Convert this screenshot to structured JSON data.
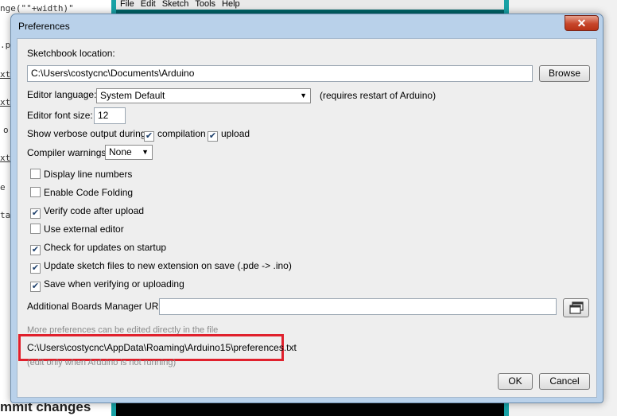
{
  "background": {
    "left_fragments": [
      "nge(\"\"+width)\"",
      ".pe",
      "xt",
      "xt",
      "o",
      "xt",
      "e",
      "ta"
    ],
    "commit_text": "mmit changes",
    "ide_menu": [
      "File",
      "Edit",
      "Sketch",
      "Tools",
      "Help"
    ]
  },
  "dialog": {
    "title": "Preferences",
    "close_glyph": "✕",
    "sketchbook": {
      "label": "Sketchbook location:",
      "value": "C:\\Users\\costycnc\\Documents\\Arduino",
      "browse_label": "Browse"
    },
    "language": {
      "label": "Editor language:",
      "selected": "System Default",
      "note": "(requires restart of Arduino)"
    },
    "font_size": {
      "label": "Editor font size:",
      "value": "12"
    },
    "verbose": {
      "label": "Show verbose output during:",
      "compilation": {
        "label": "compilation",
        "checked": true
      },
      "upload": {
        "label": "upload",
        "checked": true
      }
    },
    "warnings": {
      "label": "Compiler warnings:",
      "selected": "None"
    },
    "options": [
      {
        "label": "Display line numbers",
        "checked": false
      },
      {
        "label": "Enable Code Folding",
        "checked": false
      },
      {
        "label": "Verify code after upload",
        "checked": true
      },
      {
        "label": "Use external editor",
        "checked": false
      },
      {
        "label": "Check for updates on startup",
        "checked": true
      },
      {
        "label": "Update sketch files to new extension on save (.pde -> .ino)",
        "checked": true
      },
      {
        "label": "Save when verifying or uploading",
        "checked": true
      }
    ],
    "boards_urls": {
      "label": "Additional Boards Manager URLs:",
      "value": "",
      "button_icon": "window-copy-icon"
    },
    "more_prefs_note": "More preferences can be edited directly in the file",
    "prefs_path": "C:\\Users\\costycnc\\AppData\\Roaming\\Arduino15\\preferences.txt",
    "edit_note": "(edit only when Arduino is not running)",
    "ok_label": "OK",
    "cancel_label": "Cancel",
    "highlight_color": "#e0202c"
  }
}
